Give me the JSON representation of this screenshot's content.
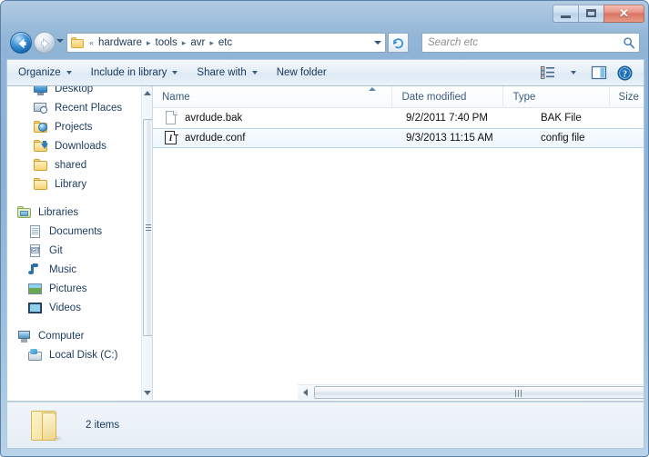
{
  "window": {
    "controls": {
      "minimize": "Minimize",
      "maximize": "Maximize",
      "close": "✕"
    }
  },
  "address": {
    "back_tooltip": "Back",
    "forward_tooltip": "Forward",
    "overflow": "«",
    "crumbs": [
      "hardware",
      "tools",
      "avr",
      "etc"
    ],
    "separator": "▸",
    "refresh": "Refresh"
  },
  "search": {
    "placeholder": "Search etc",
    "value": "Search etc"
  },
  "toolbar": {
    "organize": "Organize",
    "include_in_library": "Include in library",
    "share_with": "Share with",
    "new_folder": "New folder",
    "views": "Views",
    "preview_pane": "Preview pane",
    "help": "?"
  },
  "sidebar": {
    "groups": [
      {
        "items": [
          {
            "label": "Desktop",
            "icon": "monitor-icon",
            "level": 1
          },
          {
            "label": "Recent Places",
            "icon": "recent-places-icon",
            "level": 1
          },
          {
            "label": "Projects",
            "icon": "projects-folder-icon",
            "level": 1
          },
          {
            "label": "Downloads",
            "icon": "downloads-folder-icon",
            "level": 1
          },
          {
            "label": "shared",
            "icon": "folder-icon",
            "level": 1
          },
          {
            "label": "Library",
            "icon": "folder-icon",
            "level": 1
          }
        ]
      },
      {
        "items": [
          {
            "label": "Libraries",
            "icon": "libraries-icon",
            "level": 0
          },
          {
            "label": "Documents",
            "icon": "documents-icon",
            "level": 1
          },
          {
            "label": "Git",
            "icon": "git-icon",
            "level": 1
          },
          {
            "label": "Music",
            "icon": "music-icon",
            "level": 1
          },
          {
            "label": "Pictures",
            "icon": "pictures-icon",
            "level": 1
          },
          {
            "label": "Videos",
            "icon": "videos-icon",
            "level": 1
          }
        ]
      },
      {
        "items": [
          {
            "label": "Computer",
            "icon": "computer-icon",
            "level": 0
          },
          {
            "label": "Local Disk (C:)",
            "icon": "disk-icon",
            "level": 1
          }
        ]
      }
    ]
  },
  "columns": [
    {
      "key": "name",
      "label": "Name"
    },
    {
      "key": "date",
      "label": "Date modified"
    },
    {
      "key": "type",
      "label": "Type"
    },
    {
      "key": "size",
      "label": "Size"
    }
  ],
  "files": [
    {
      "name": "avrdude.bak",
      "date": "9/2/2011 7:40 PM",
      "type": "BAK File",
      "size": "",
      "icon": "blank-file-icon",
      "selected": false
    },
    {
      "name": "avrdude.conf",
      "date": "9/3/2013 11:15 AM",
      "type": "config file",
      "size": "",
      "icon": "config-file-icon",
      "selected": true,
      "icon_glyph": "I"
    }
  ],
  "status": {
    "item_count": "2 items"
  },
  "colors": {
    "frame": "#8cb2d5",
    "toolbar_text": "#14365c",
    "selection_border": "#b6d5ef",
    "close_button": "#ce4f37"
  }
}
